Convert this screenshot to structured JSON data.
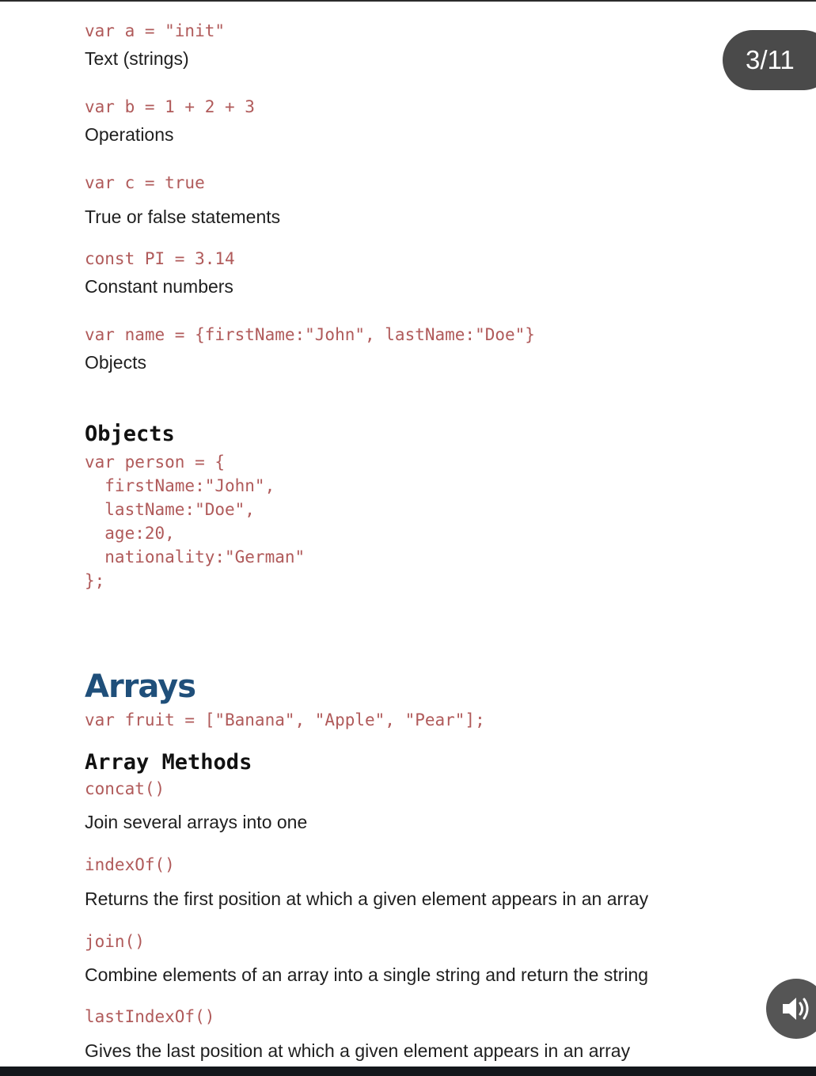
{
  "slide_counter": "3/11",
  "variables": [
    {
      "code": "var a = \"init\"",
      "desc": "Text (strings)"
    },
    {
      "code": "var b = 1 + 2 + 3",
      "desc": "Operations"
    },
    {
      "code": "var c = true",
      "desc": "True or false statements"
    },
    {
      "code": "const PI = 3.14",
      "desc": "Constant numbers"
    },
    {
      "code": "var name = {firstName:\"John\", lastName:\"Doe\"}",
      "desc": "Objects"
    }
  ],
  "objects_section": {
    "title": "Objects",
    "code_lines": [
      "var person = {",
      "  firstName:\"John\",",
      "  lastName:\"Doe\",",
      "  age:20,",
      "  nationality:\"German\"",
      "};"
    ]
  },
  "arrays_section": {
    "title": "Arrays",
    "code": "var fruit = [\"Banana\", \"Apple\", \"Pear\"];",
    "methods_title": "Array Methods",
    "methods": [
      {
        "name": "concat()",
        "desc": "Join several arrays into one"
      },
      {
        "name": "indexOf()",
        "desc": "Returns the first position at which a given element appears in an array"
      },
      {
        "name": "join()",
        "desc": "Combine elements of an array into a single string and return the string"
      },
      {
        "name": "lastIndexOf()",
        "desc": "Gives the last position at which a given element appears in an array"
      }
    ]
  },
  "icons": {
    "audio": "speaker-icon"
  }
}
